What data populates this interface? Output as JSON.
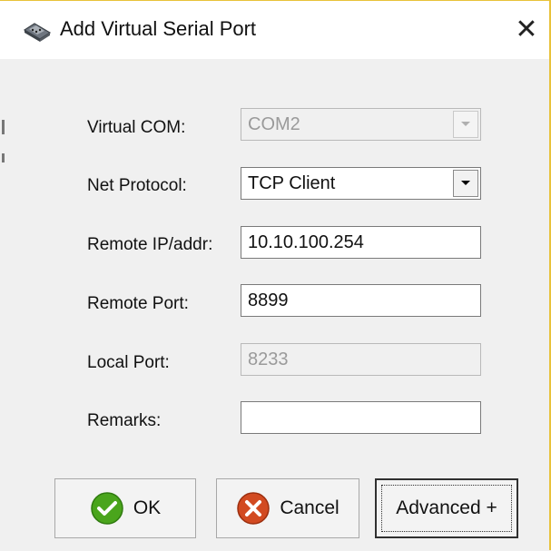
{
  "window": {
    "title": "Add Virtual Serial Port",
    "close_symbol": "✕",
    "icon": "serial-port-icon",
    "border_accent": "#e8c23a"
  },
  "form": {
    "virtual_com": {
      "label": "Virtual COM:",
      "value": "COM2",
      "enabled": false
    },
    "net_protocol": {
      "label": "Net Protocol:",
      "value": "TCP Client",
      "enabled": true
    },
    "remote_ip": {
      "label": "Remote IP/addr:",
      "value": "10.10.100.254",
      "enabled": true
    },
    "remote_port": {
      "label": "Remote Port:",
      "value": "8899",
      "enabled": true
    },
    "local_port": {
      "label": "Local Port:",
      "value": "8233",
      "enabled": false
    },
    "remarks": {
      "label": "Remarks:",
      "value": "",
      "enabled": true
    }
  },
  "buttons": {
    "ok": {
      "label": "OK",
      "icon": "check-circle-icon",
      "color": "#4aa51c"
    },
    "cancel": {
      "label": "Cancel",
      "icon": "x-circle-icon",
      "color": "#d24a21"
    },
    "advanced": {
      "label": "Advanced +"
    }
  }
}
